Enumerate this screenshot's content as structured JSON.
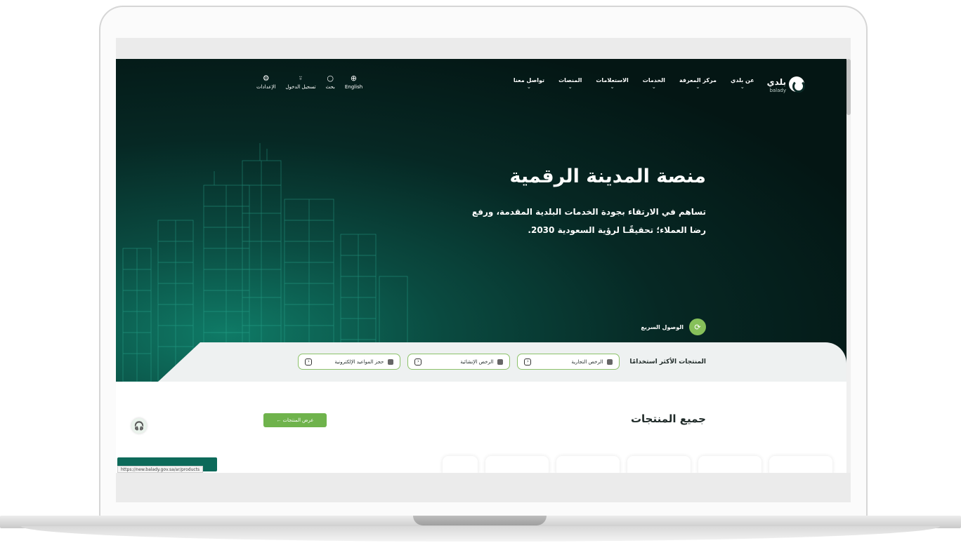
{
  "nav": {
    "logo_text": "بلدي",
    "logo_sub": "balady",
    "menu": [
      {
        "label": "عن بلدي"
      },
      {
        "label": "مركز المعرفة"
      },
      {
        "label": "الخدمات"
      },
      {
        "label": "الاستعلامات"
      },
      {
        "label": "المنصات"
      },
      {
        "label": "تواصل معنا"
      }
    ],
    "tools": {
      "language": "English",
      "search": "بحث",
      "login": "تسجيل الدخول",
      "settings": "الإعدادات"
    }
  },
  "hero": {
    "title": "منصة المدينة الرقمية",
    "description": "تساهم في الارتقاء بجودة الخدمات البلدية المقدمة، ورفع رضا العملاء؛ تحقيقًـا لرؤية السعودية 2030.",
    "quick_access": "الوصول السريع"
  },
  "most_used": {
    "title": "المنتجات الأكثر استخدامًا",
    "items": [
      {
        "label": "الرخص التجارية"
      },
      {
        "label": "الرخص الإنشائية"
      },
      {
        "label": "حجز المواعيد الإلكترونية"
      }
    ]
  },
  "all_products": {
    "title": "جميع المنتجات",
    "view_button": "عرض المنتجات ←"
  },
  "status_url": "https://new.balady.gov.sa/ar/products",
  "colors": {
    "accent_green": "#6fb34c",
    "hero_dark": "#041614",
    "hero_teal": "#0f7a66"
  }
}
